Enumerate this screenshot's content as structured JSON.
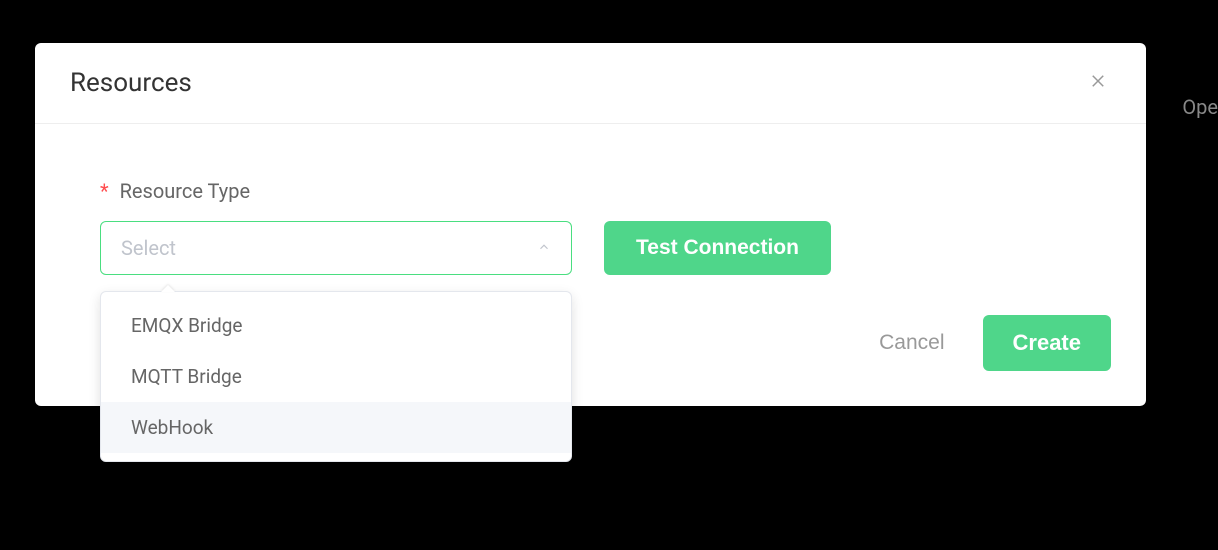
{
  "background": {
    "partial_text": "Ope"
  },
  "modal": {
    "title": "Resources",
    "form": {
      "resource_type_label": "Resource Type",
      "select_placeholder": "Select",
      "test_button_label": "Test Connection",
      "options": [
        {
          "label": "EMQX Bridge",
          "hovered": false
        },
        {
          "label": "MQTT Bridge",
          "hovered": false
        },
        {
          "label": "WebHook",
          "hovered": true
        }
      ]
    },
    "footer": {
      "cancel_label": "Cancel",
      "create_label": "Create"
    }
  }
}
